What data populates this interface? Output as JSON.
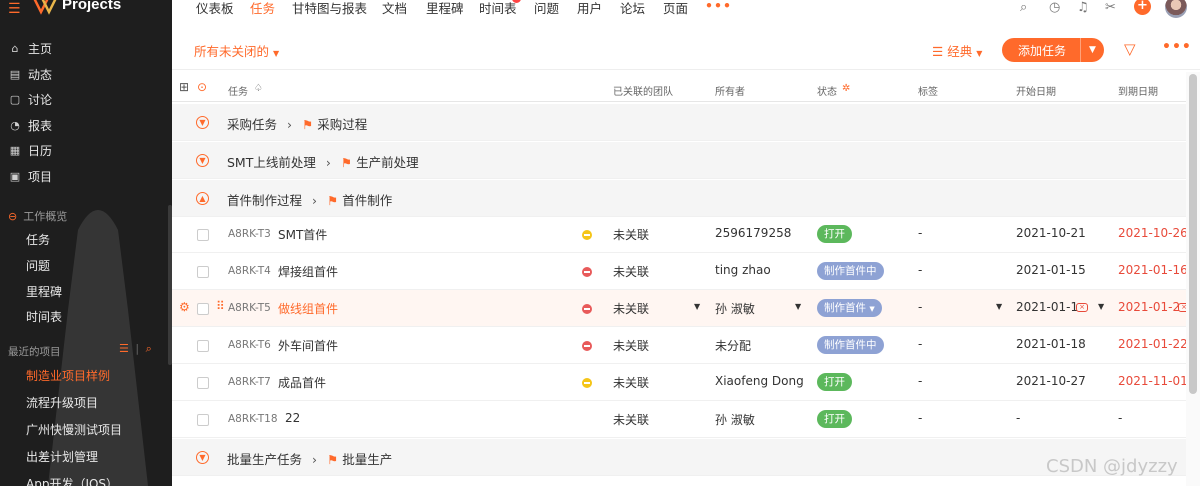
{
  "app": {
    "title": "Projects"
  },
  "sidebar": {
    "items": [
      {
        "label": "主页",
        "icon": "home-icon"
      },
      {
        "label": "动态",
        "icon": "feed-icon"
      },
      {
        "label": "讨论",
        "icon": "discussion-icon"
      },
      {
        "label": "报表",
        "icon": "report-icon"
      },
      {
        "label": "日历",
        "icon": "calendar-icon"
      },
      {
        "label": "项目",
        "icon": "project-icon"
      }
    ],
    "work_overview": "工作概览",
    "work_items": [
      "任务",
      "问题",
      "里程碑",
      "时间表"
    ],
    "recent_label": "最近的项目",
    "recent_projects": [
      "制造业项目样例",
      "流程升级项目",
      "广州快慢测试项目",
      "出差计划管理",
      "App开发（IOS）"
    ]
  },
  "topnav": {
    "tabs": [
      "仪表板",
      "任务",
      "甘特图与报表",
      "文档",
      "里程碑",
      "时间表",
      "问题",
      "用户",
      "论坛",
      "页面"
    ],
    "active_tab": "任务",
    "timesheet_badge": "1"
  },
  "filter": {
    "current": "所有未关闭的",
    "view": "经典",
    "add_task": "添加任务"
  },
  "columns": {
    "task": "任务",
    "team": "已关联的团队",
    "owner": "所有者",
    "status": "状态",
    "tags": "标签",
    "start": "开始日期",
    "due": "到期日期"
  },
  "groups": [
    {
      "name": "采购任务",
      "milestone": "采购过程"
    },
    {
      "name": "SMT上线前处理",
      "milestone": "生产前处理"
    },
    {
      "name": "首件制作过程",
      "milestone": "首件制作"
    },
    {
      "name": "批量生产任务",
      "milestone": "批量生产"
    }
  ],
  "tasks": [
    {
      "id": "A8RK-T3",
      "name": "SMT首件",
      "priority": "medium",
      "team": "未关联",
      "owner": "2596179258",
      "status": "打开",
      "tag": "-",
      "start": "2021-10-21",
      "due": "2021-10-26"
    },
    {
      "id": "A8RK-T4",
      "name": "焊接组首件",
      "priority": "high",
      "team": "未关联",
      "owner": "ting zhao",
      "status": "制作首件中",
      "tag": "-",
      "start": "2021-01-15",
      "due": "2021-01-16"
    },
    {
      "id": "A8RK-T5",
      "name": "做线组首件",
      "priority": "high",
      "team": "未关联",
      "owner": "孙 淑敏",
      "status": "制作首件",
      "tag": "-",
      "start": "2021-01-1",
      "due": "2021-01-2"
    },
    {
      "id": "A8RK-T6",
      "name": "外车间首件",
      "priority": "high",
      "team": "未关联",
      "owner": "未分配",
      "status": "制作首件中",
      "tag": "-",
      "start": "2021-01-18",
      "due": "2021-01-22"
    },
    {
      "id": "A8RK-T7",
      "name": "成品首件",
      "priority": "medium",
      "team": "未关联",
      "owner": "Xiaofeng Dong",
      "status": "打开",
      "tag": "-",
      "start": "2021-10-27",
      "due": "2021-11-01"
    },
    {
      "id": "A8RK-T18",
      "name": "22",
      "priority": "",
      "team": "未关联",
      "owner": "孙 淑敏",
      "status": "打开",
      "tag": "-",
      "start": "-",
      "due": "-"
    }
  ],
  "watermark": "CSDN @jdyzzy",
  "colors": {
    "accent": "#ff6a2b",
    "open": "#5cb85c",
    "in_progress": "#8ea2d4",
    "overdue": "#e84a3a"
  }
}
